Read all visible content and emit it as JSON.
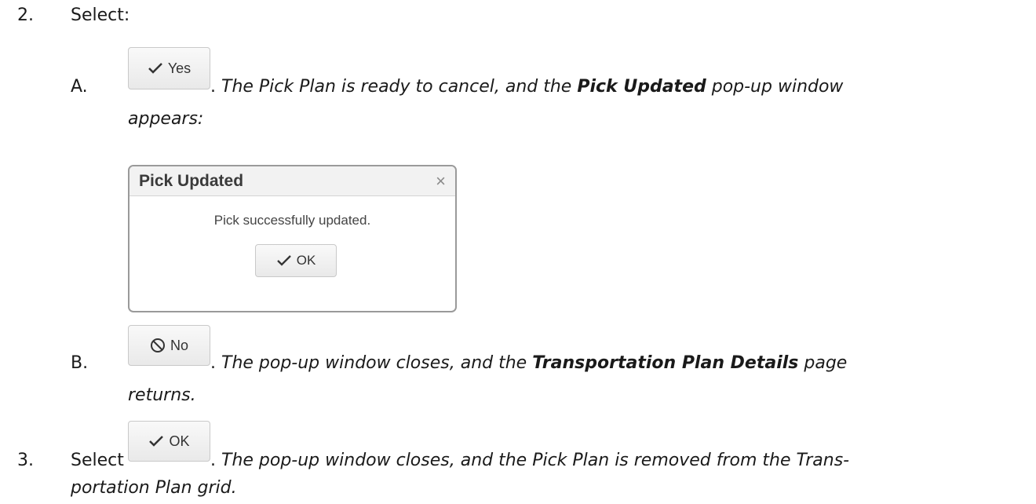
{
  "steps": [
    {
      "number": "2.",
      "text": "Select:",
      "options": [
        {
          "letter": "A.",
          "button_label": "Yes",
          "desc_part1": ". ",
          "desc_part2": "The Pick Plan is ready to cancel, and the ",
          "desc_bold": "Pick Updated",
          "desc_part3": " pop-up window",
          "desc_line2": "appears:"
        },
        {
          "letter": "B.",
          "button_label": "No",
          "desc_part1": ". ",
          "desc_part2": "The pop-up window closes, and the ",
          "desc_bold": "Transportation Plan Details",
          "desc_part3": " page",
          "desc_line2": "returns."
        }
      ]
    },
    {
      "number": "3.",
      "text": "Select",
      "button_label": "OK",
      "desc_part1": ". ",
      "desc_part2": "The pop-up window closes, and the Pick Plan is removed from the Trans-",
      "desc_line2": "portation Plan grid."
    }
  ],
  "dialog": {
    "title": "Pick Updated",
    "close_glyph": "×",
    "message": "Pick successfully updated.",
    "ok_label": "OK"
  },
  "icons": {
    "yes": "checkmark-icon",
    "no": "prohibited-icon",
    "ok": "checkmark-icon",
    "close": "close-icon"
  }
}
